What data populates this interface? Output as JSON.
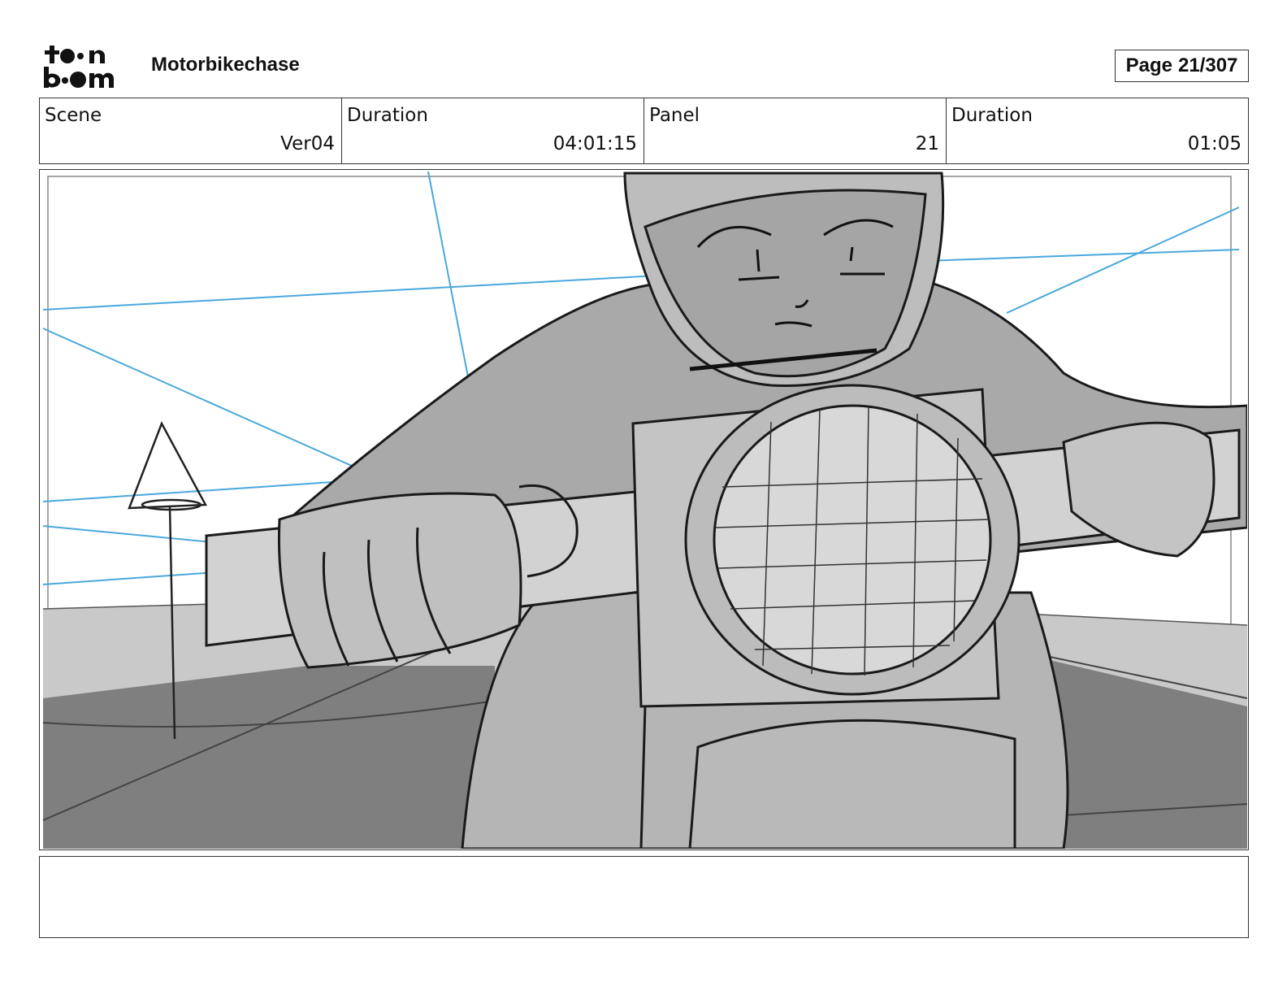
{
  "header": {
    "logo_text_top": "toon",
    "logo_text_bottom": "boom",
    "project_title": "Motorbikechase",
    "page_label": "Page",
    "page_number": "21/307"
  },
  "info": {
    "scene_label": "Scene",
    "scene_value": "Ver04",
    "scene_duration_label": "Duration",
    "scene_duration_value": "04:01:15",
    "panel_label": "Panel",
    "panel_value": "21",
    "panel_duration_label": "Duration",
    "panel_duration_value": "01:05"
  },
  "panel": {
    "description": ""
  },
  "colors": {
    "perspective_lines": "#4aa8dc",
    "sketch_ink": "#1a1a1a",
    "light_gray": "#c8c8c8",
    "mid_gray": "#a8a8a8",
    "dark_gray": "#7c7c7c"
  }
}
